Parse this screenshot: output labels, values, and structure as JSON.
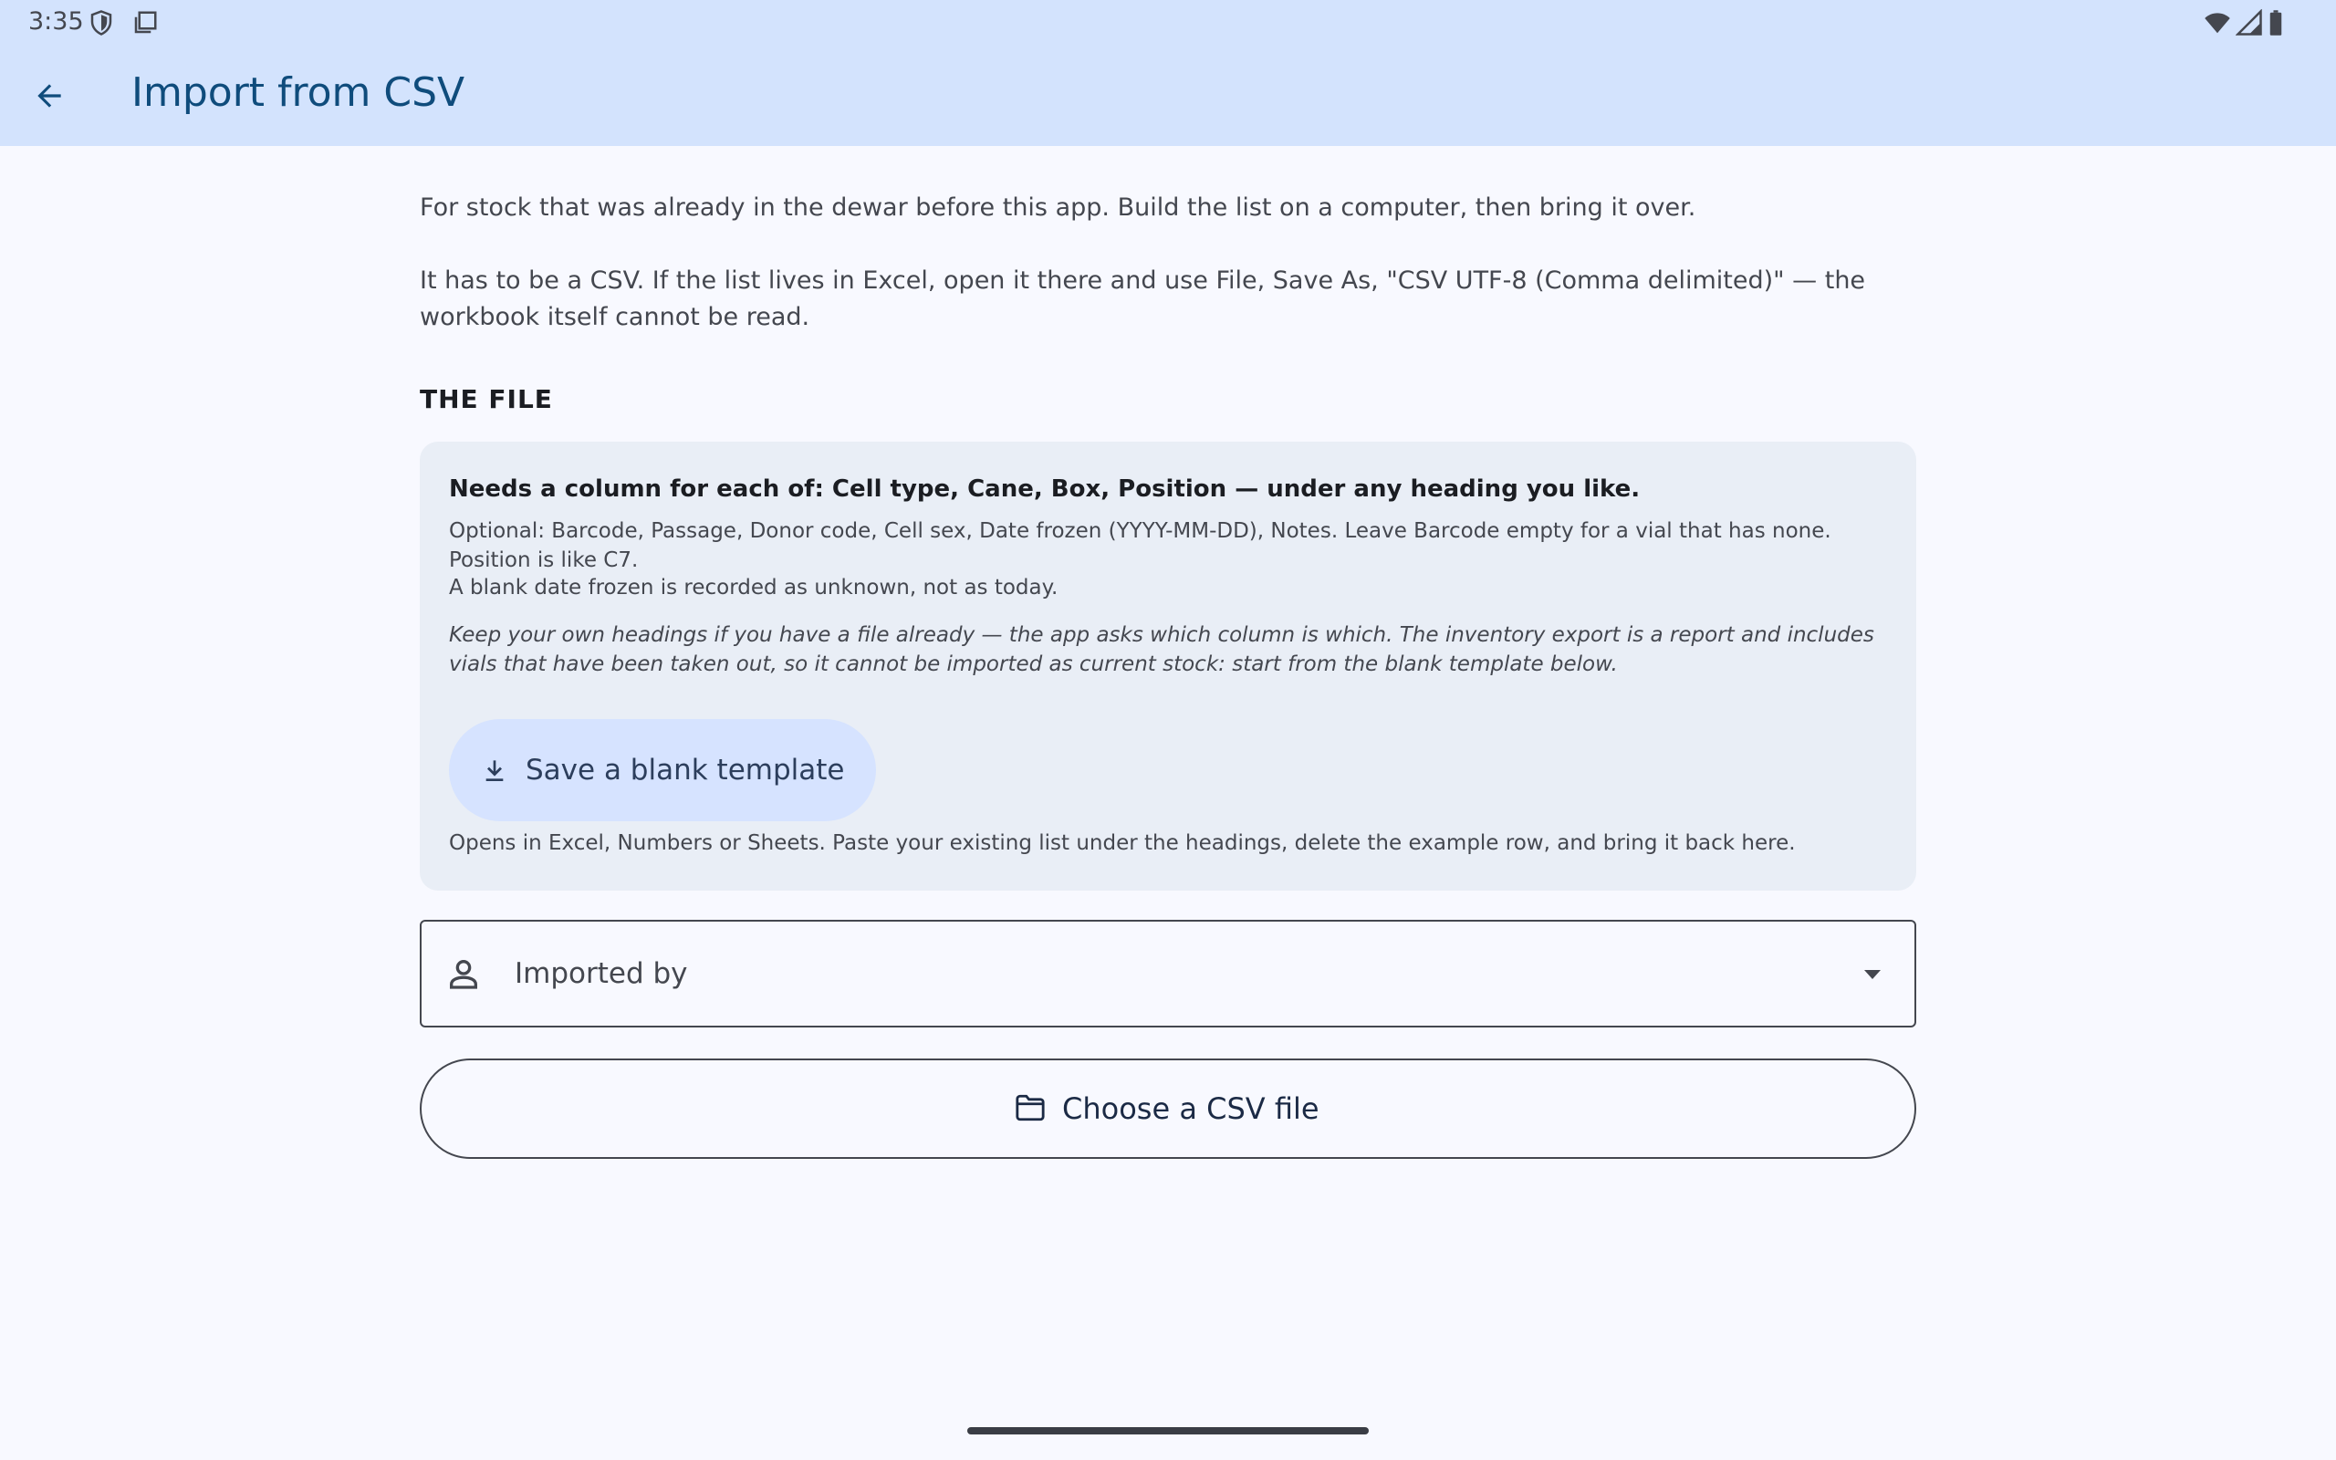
{
  "status_bar": {
    "time": "3:35",
    "left_icons": [
      "shield-icon",
      "screenshot-icon"
    ],
    "right_icons": [
      "wifi-icon",
      "cell-signal-icon",
      "battery-icon"
    ]
  },
  "app_bar": {
    "title": "Import from CSV",
    "back_icon": "arrow-back-icon"
  },
  "intro": {
    "paragraph_1": "For stock that was already in the dewar before this app. Build the list on a computer, then bring it over.",
    "paragraph_2": "It has to be a CSV. If the list lives in Excel, open it there and use File, Save As, \"CSV UTF-8 (Comma delimited)\" — the workbook itself cannot be read."
  },
  "file_section": {
    "heading": "THE FILE",
    "card": {
      "heading": "Needs a column for each of: Cell type, Cane, Box, Position — under any heading you like.",
      "optional": "Optional: Barcode, Passage, Donor code, Cell sex, Date frozen (YYYY-MM-DD), Notes. Leave Barcode empty for a vial that has none. Position is like C7.",
      "blank_date": "A blank date frozen is recorded as unknown, not as today.",
      "italic_note": "Keep your own headings if you have a file already — the app asks which column is which. The inventory export is a report and includes vials that have been taken out, so it cannot be imported as current stock: start from the blank template below.",
      "template_button": "Save a blank template",
      "footnote": "Opens in Excel, Numbers or Sheets. Paste your existing list under the headings, delete the example row, and bring it back here."
    }
  },
  "imported_by": {
    "label": "Imported by",
    "icon": "person-icon"
  },
  "choose_csv": {
    "label": "Choose a CSV file",
    "icon": "folder-icon"
  },
  "colors": {
    "app_bar": "#d3e3fd",
    "background": "#f8f9ff",
    "card": "#e9eef6",
    "tonal_button": "#d6e3ff",
    "title": "#0f4c7c"
  }
}
